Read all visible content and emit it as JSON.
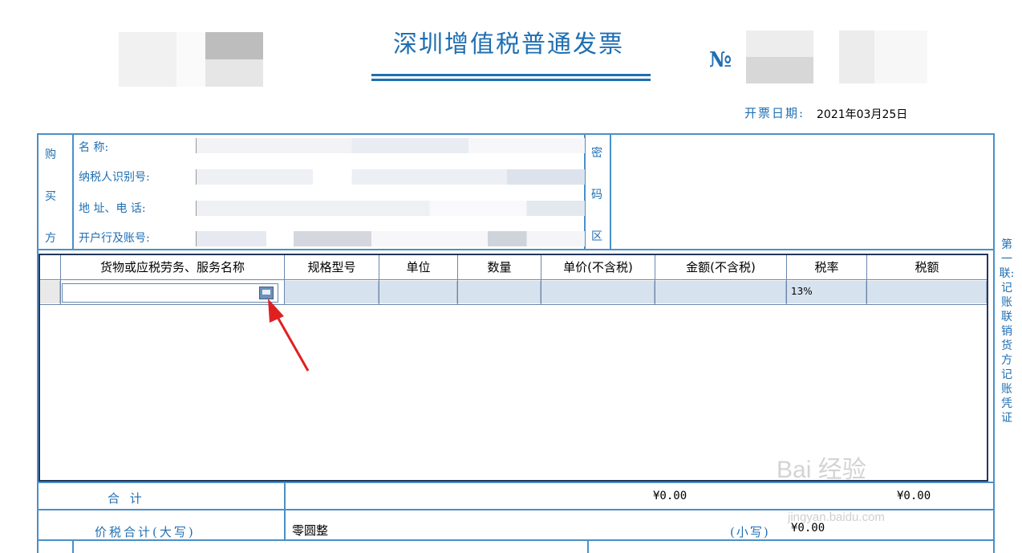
{
  "header": {
    "title": "深圳增值税普通发票",
    "no_label": "№",
    "date_label": "开票日期:",
    "date_value": "2021年03月25日"
  },
  "buyer": {
    "side_label_chars": [
      "购",
      "买",
      "方"
    ],
    "fields": [
      {
        "label": "名        称:"
      },
      {
        "label": "纳税人识别号:"
      },
      {
        "label": "地 址、电 话:"
      },
      {
        "label": "开户行及账号:"
      }
    ],
    "cipher_chars": [
      "密",
      "码",
      "区"
    ]
  },
  "items_table": {
    "columns": [
      "货物或应税劳务、服务名称",
      "规格型号",
      "单位",
      "数量",
      "单价(不含税)",
      "金额(不含税)",
      "税率",
      "税额"
    ],
    "rows": [
      {
        "name": "",
        "spec": "",
        "unit": "",
        "qty": "",
        "price": "",
        "amount": "",
        "tax_rate": "13%",
        "tax": ""
      }
    ]
  },
  "totals": {
    "sum_label": "合          计",
    "amount_total": "¥0.00",
    "tax_total": "¥0.00",
    "grand_label": "价税合计(大写)",
    "grand_upper": "零圆整",
    "small_label": "(小写)",
    "grand_small": "¥0.00"
  },
  "side_note": "第一联:记账联 销货方记账凭证",
  "watermark": {
    "main": "Bai 经验",
    "sub": "jingyan.baidu.com"
  },
  "colors": {
    "accent": "#1f6fb3",
    "grid": "#4a90c8",
    "row_bg": "#d7e2ef",
    "arrow": "#e02020"
  }
}
